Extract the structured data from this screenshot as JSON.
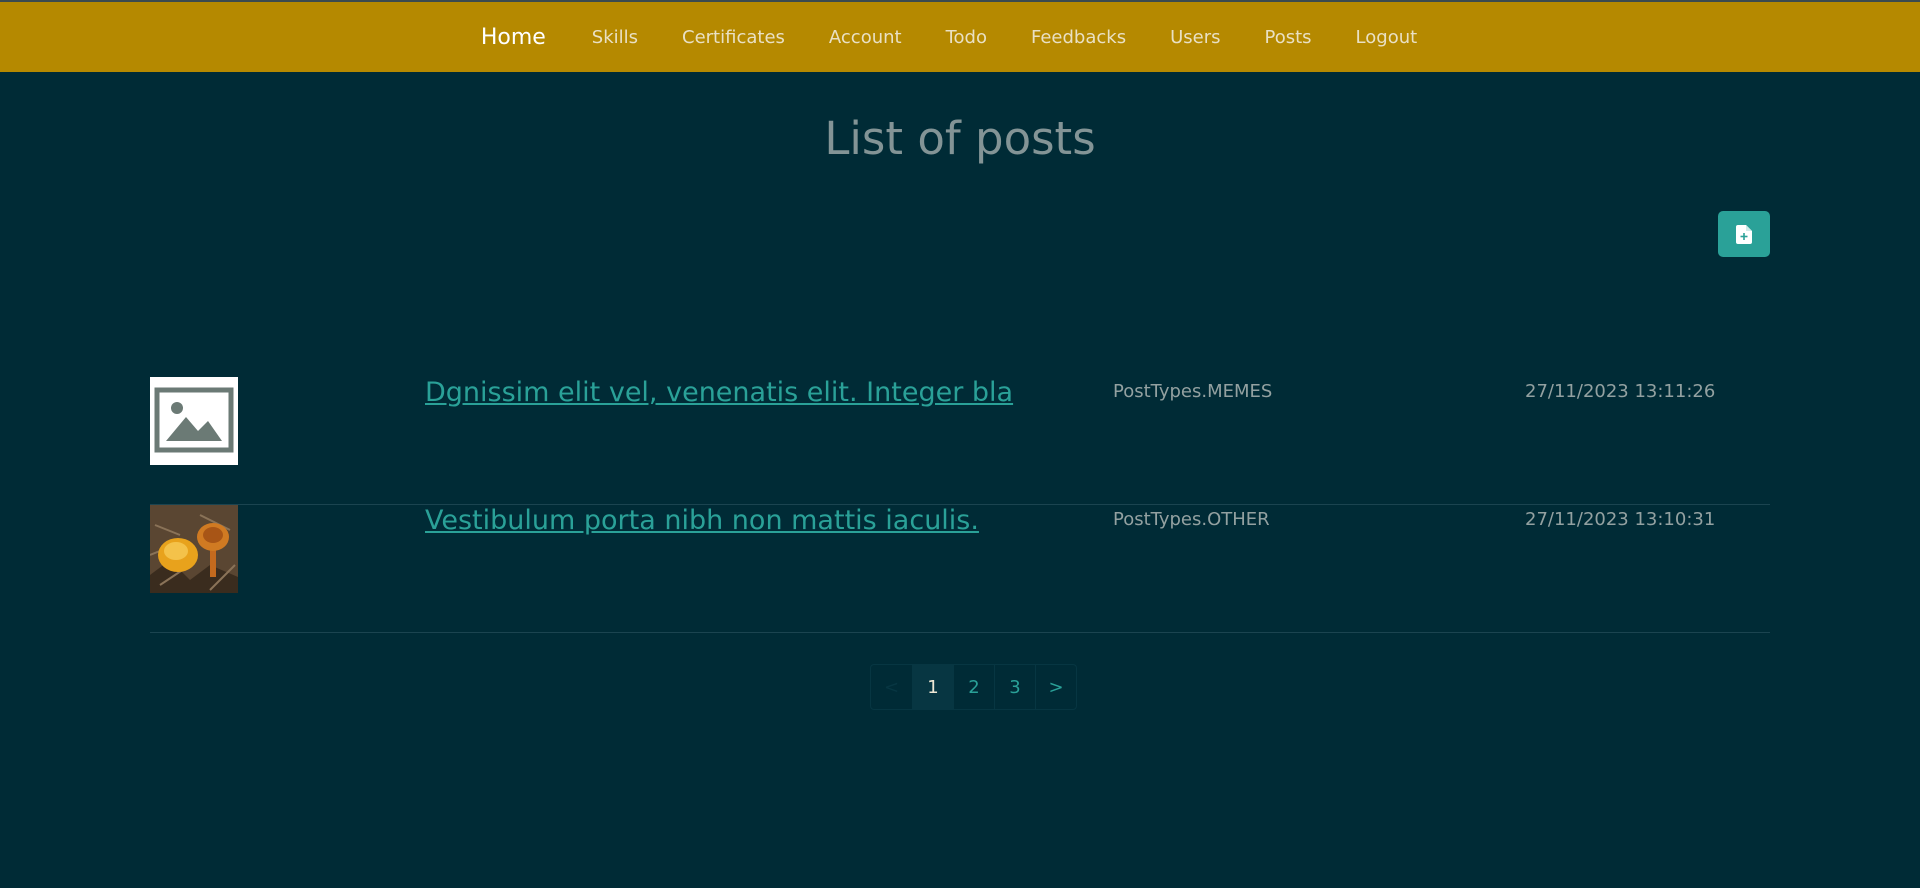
{
  "nav": {
    "brand": "Home",
    "links": [
      "Skills",
      "Certificates",
      "Account",
      "Todo",
      "Feedbacks",
      "Users",
      "Posts",
      "Logout"
    ]
  },
  "page": {
    "title": "List of posts",
    "new_post_icon": "file-plus-icon"
  },
  "posts": [
    {
      "title": "Dgnissim elit vel, venenatis elit. Integer bla",
      "type": "PostTypes.MEMES",
      "date": "27/11/2023 13:11:26",
      "thumbnail": "image-placeholder-icon"
    },
    {
      "title": "Vestibulum porta nibh non mattis iaculis.",
      "type": "PostTypes.OTHER",
      "date": "27/11/2023 13:10:31",
      "thumbnail": "mushroom-photo"
    }
  ],
  "pagination": {
    "prev": "<",
    "pages": [
      "1",
      "2",
      "3"
    ],
    "next": ">",
    "active": "1"
  },
  "colors": {
    "navbar": "#b58900",
    "background": "#002b36",
    "accent": "#2aa198"
  }
}
